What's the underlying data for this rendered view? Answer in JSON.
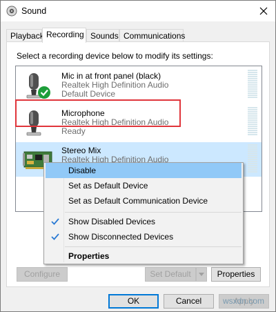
{
  "window": {
    "title": "Sound"
  },
  "tabs": [
    {
      "label": "Playback",
      "active": false
    },
    {
      "label": "Recording",
      "active": true
    },
    {
      "label": "Sounds",
      "active": false
    },
    {
      "label": "Communications",
      "active": false
    }
  ],
  "recording": {
    "instruction": "Select a recording device below to modify its settings:",
    "devices": [
      {
        "name": "Mic in at front panel (black)",
        "driver": "Realtek High Definition Audio",
        "status": "Default Device",
        "icon": "microphone-icon",
        "badge": "default-check"
      },
      {
        "name": "Microphone",
        "driver": "Realtek High Definition Audio",
        "status": "Ready",
        "icon": "microphone-icon"
      },
      {
        "name": "Stereo Mix",
        "driver": "Realtek High Definition Audio",
        "status": "",
        "icon": "sound-card-icon",
        "selected": true
      }
    ],
    "buttons": {
      "configure": "Configure",
      "set_default": "Set Default",
      "properties": "Properties"
    }
  },
  "context_menu": {
    "items": [
      {
        "label": "Disable",
        "highlighted": true
      },
      {
        "label": "Set as Default Device"
      },
      {
        "label": "Set as Default Communication Device"
      },
      {
        "label": "Show Disabled Devices",
        "checked": true
      },
      {
        "label": "Show Disconnected Devices",
        "checked": true
      },
      {
        "label": "Properties",
        "bold": true
      }
    ]
  },
  "footer": {
    "ok": "OK",
    "cancel": "Cancel",
    "apply": "Apply"
  },
  "watermark": "wsxdn.com",
  "colors": {
    "selection": "#cce8ff",
    "menu_highlight": "#91c9f7",
    "annotation_red": "#e0343a",
    "check_green": "#1e9e3a",
    "accent": "#0078d7"
  }
}
